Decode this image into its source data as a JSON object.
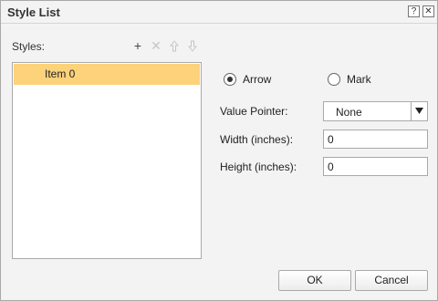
{
  "window": {
    "title": "Style List",
    "help_glyph": "?",
    "close_glyph": "✕"
  },
  "styles": {
    "label": "Styles:",
    "toolbar": [
      "plus-icon",
      "delete-icon",
      "move-up-icon",
      "move-down-icon"
    ],
    "items": [
      {
        "label": "Item 0",
        "selected": true
      }
    ],
    "selected_color": "#fcd27a"
  },
  "options": {
    "arrow_label": "Arrow",
    "mark_label": "Mark",
    "selected": "Arrow"
  },
  "form": {
    "pointer_label": "Value Pointer:",
    "pointer_value": "None",
    "width_label": "Width (inches):",
    "width_value": "0",
    "height_label": "Height (inches):",
    "height_value": "0"
  },
  "buttons": {
    "ok": "OK",
    "cancel": "Cancel"
  }
}
